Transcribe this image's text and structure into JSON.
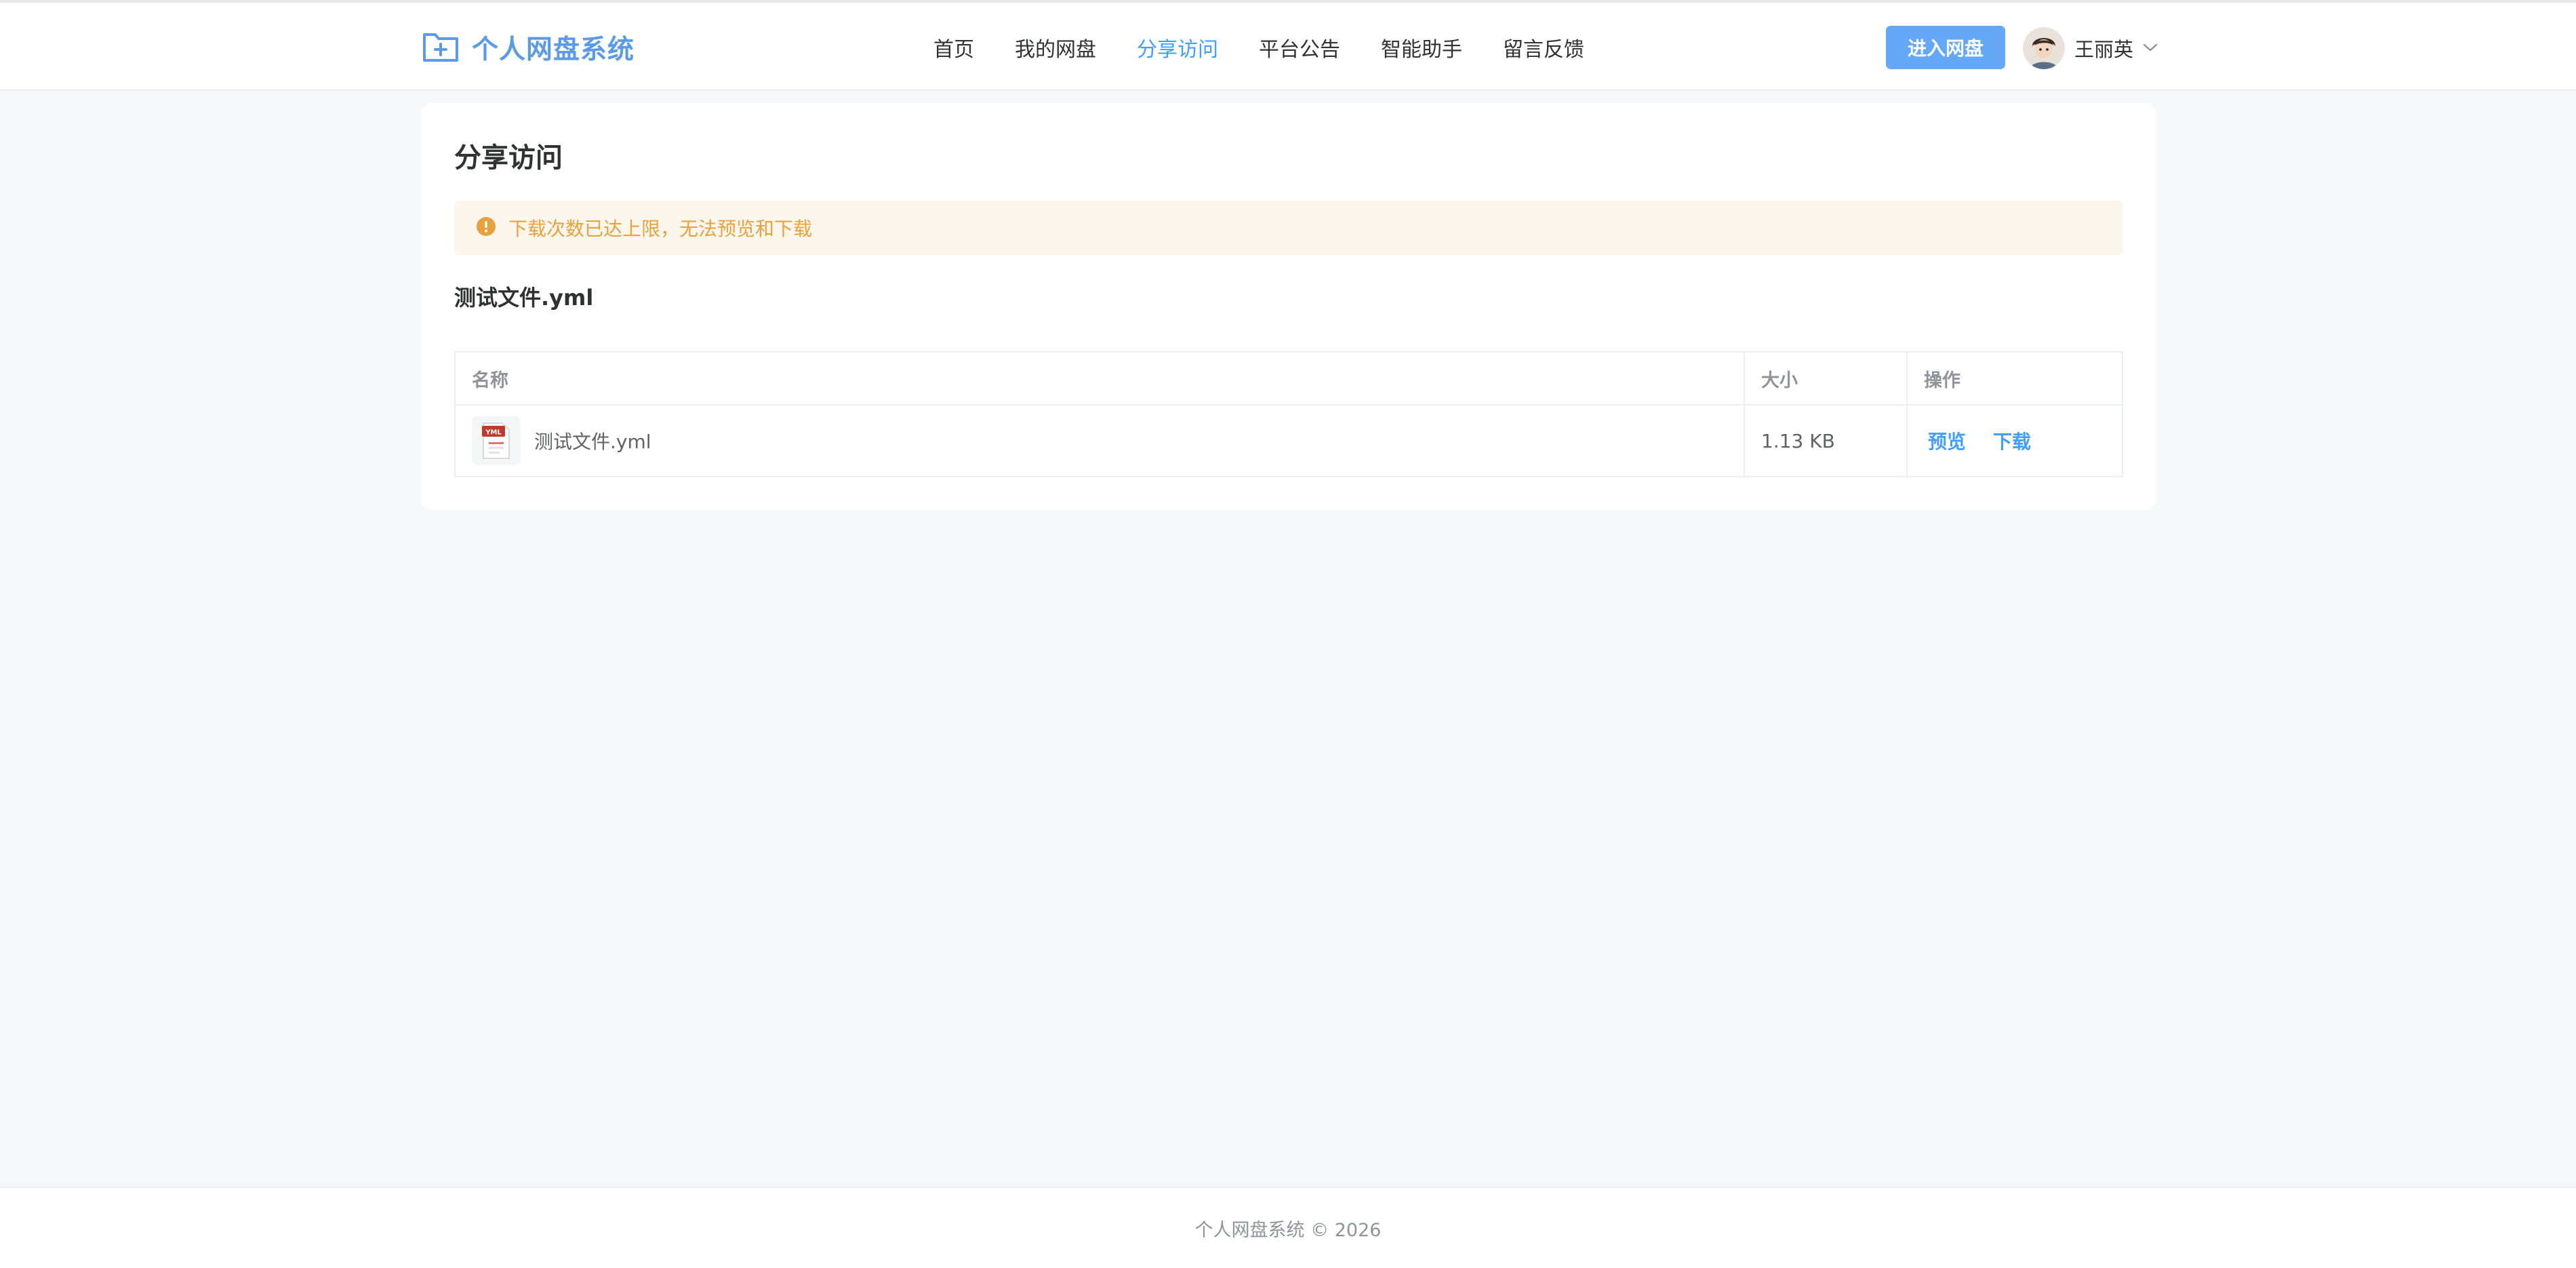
{
  "header": {
    "brand": "个人网盘系统",
    "nav": [
      "首页",
      "我的网盘",
      "分享访问",
      "平台公告",
      "智能助手",
      "留言反馈"
    ],
    "active_nav": "分享访问",
    "enter_button": "进入网盘",
    "user_name": "王丽英"
  },
  "main": {
    "title": "分享访问",
    "alert": "下载次数已达上限，无法预览和下载",
    "file_title": "测试文件.yml",
    "table": {
      "headers": [
        "名称",
        "大小",
        "操作"
      ],
      "rows": [
        {
          "icon_label": "YML",
          "name": "测试文件.yml",
          "size": "1.13 KB",
          "actions": [
            "预览",
            "下载"
          ]
        }
      ]
    }
  },
  "footer": {
    "text": "个人网盘系统 © 2026"
  },
  "colors": {
    "accent": "#409eff",
    "brand": "#5b9be6",
    "warning": "#e6a23c",
    "warning_bg": "#fdf6ec"
  }
}
